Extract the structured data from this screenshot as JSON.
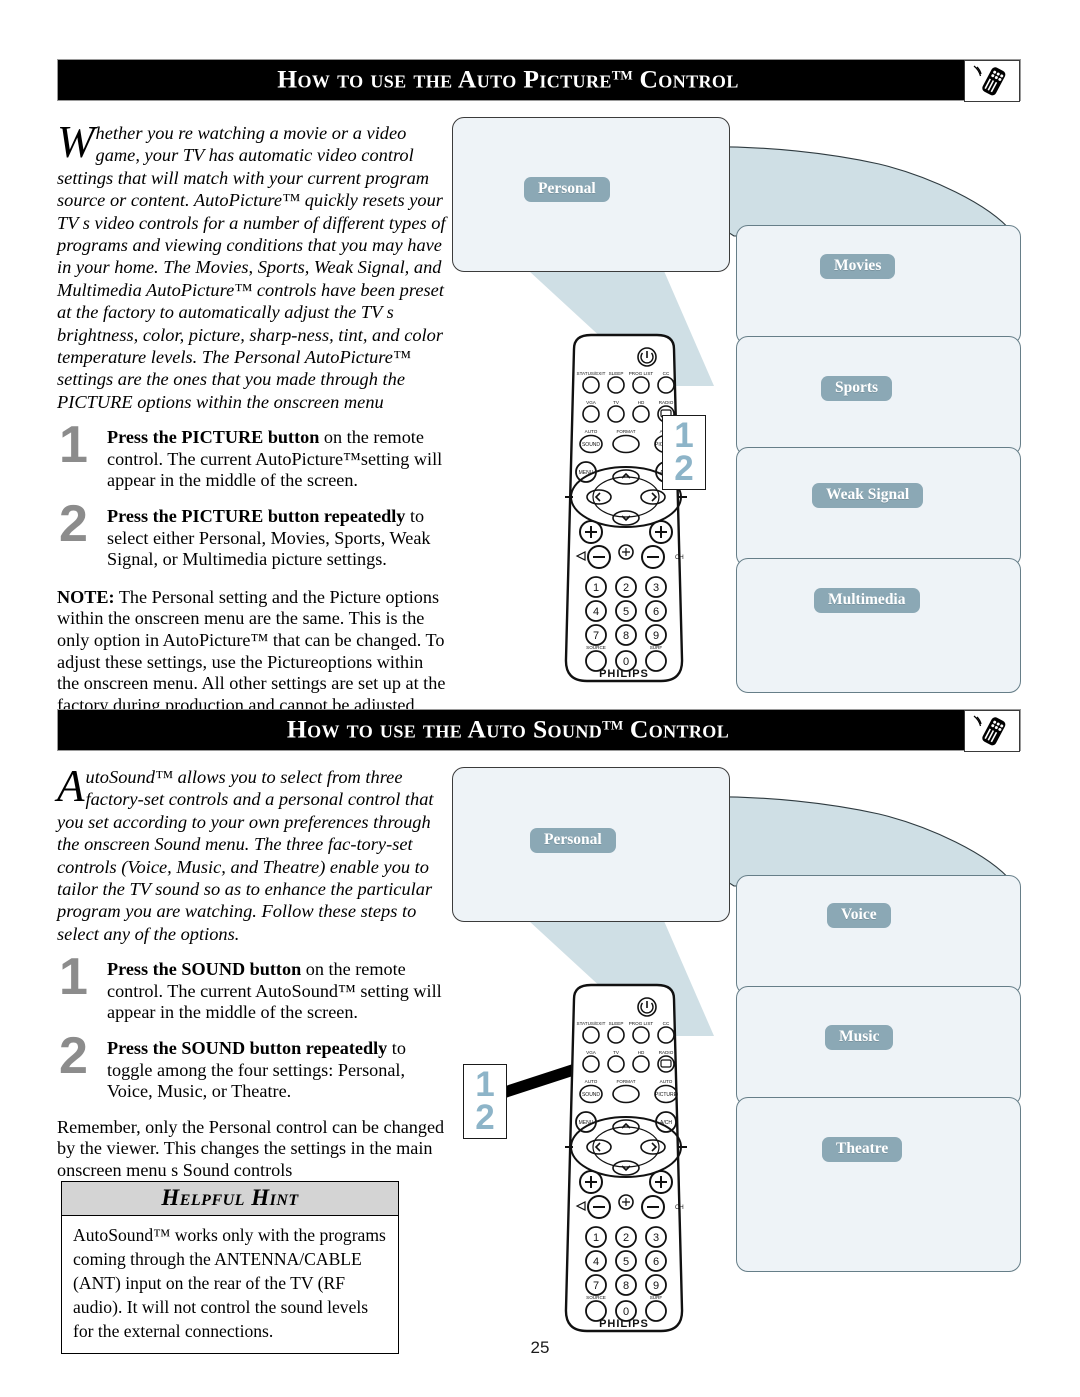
{
  "page": {
    "number": "25"
  },
  "section1": {
    "header": {
      "title_pre": "How to use the Auto Picture",
      "title_tm": "TM",
      "title_post": " Control",
      "icon": "remote-control-icon"
    },
    "intro": {
      "dropcap": "W",
      "text": "hether you re watching a movie or a video game, your TV has automatic video control settings that will match with your current program source or content.  AutoPicture™ quickly resets your TV s video controls for a number of different types of programs and viewing conditions that you may have in your home.  The Movies, Sports, Weak Signal, and Multimedia AutoPicture™ controls have been preset at the factory to automatically adjust the TV s brightness, color, picture, sharp-ness, tint, and color temperature levels.  The Personal AutoPicture™ settings are the ones that you made through the PICTURE options within the onscreen menu"
    },
    "steps": [
      {
        "number": "1",
        "bold": "Press the PICTURE button",
        "rest": " on the remote control.  The current AutoPicture™setting will appear in the middle of the screen."
      },
      {
        "number": "2",
        "bold": "Press the PICTURE button repeatedly",
        "rest": " to select either Personal, Movies, Sports, Weak Signal, or Multimedia picture settings."
      }
    ],
    "note": {
      "label": "NOTE:",
      "text": "  The Personal setting and the Picture options within the onscreen menu are the same. This is the only option in AutoPicture™ that can be changed. To adjust these settings, use the Pictureoptions within the onscreen menu. All other settings are set up at the factory during production and cannot be adjusted."
    },
    "diagram": {
      "callout": {
        "line1": "1",
        "line2": "2"
      },
      "panels": [
        {
          "label": "Personal"
        },
        {
          "label": "Movies"
        },
        {
          "label": "Sports"
        },
        {
          "label": "Weak Signal"
        },
        {
          "label": "Multimedia"
        }
      ]
    }
  },
  "section2": {
    "header": {
      "title_pre": "How to use the Auto Sound",
      "title_tm": "TM",
      "title_post": " Control",
      "icon": "remote-control-icon"
    },
    "intro": {
      "dropcap": "A",
      "text": "utoSound™ allows you to select from three factory-set controls and a personal control that you set according to your own preferences through the onscreen Sound menu. The three fac-tory-set controls (Voice, Music, and Theatre) enable you to tailor the TV sound so as to enhance the particular program you are watching.  Follow these steps to select any of the options."
    },
    "steps": [
      {
        "number": "1",
        "bold": "Press the SOUND button",
        "rest": " on the remote control.  The current AutoSound™ setting will appear in the middle of the screen."
      },
      {
        "number": "2",
        "bold": "Press the SOUND button repeatedly",
        "rest": " to toggle among the four settings:  Personal, Voice, Music, or Theatre."
      }
    ],
    "after": "Remember, only the Personal control can be changed by the viewer.  This changes the settings in the main onscreen menu s Sound controls",
    "hint": {
      "title": "Helpful Hint",
      "body": "AutoSound™ works only with the programs coming through the ANTENNA/CABLE (ANT) input on the rear of the TV (RF audio).  It will not control the sound levels for the external connections."
    },
    "diagram": {
      "callout": {
        "line1": "1",
        "line2": "2"
      },
      "panels": [
        {
          "label": "Personal"
        },
        {
          "label": "Voice"
        },
        {
          "label": "Music"
        },
        {
          "label": "Theatre"
        }
      ]
    }
  },
  "remote": {
    "brand": "PHILIPS",
    "rows": [
      [
        "STATUS/EXIT",
        "SLEEP",
        "PROG LIST",
        "CC"
      ],
      [
        "VGA",
        "TV",
        "HD",
        "RADIO"
      ],
      [
        "AUTO SOUND",
        "FORMAT",
        "AUTO PICTURE"
      ]
    ],
    "nav": {
      "menu": "MENU",
      "ach": "A/CH"
    },
    "volume_label": "VOL",
    "channel_label": "CH",
    "keypad": [
      "1",
      "2",
      "3",
      "4",
      "5",
      "6",
      "7",
      "8",
      "9",
      "0"
    ],
    "keypad_extra": {
      "source": "SOURCE",
      "surf": "SURF"
    }
  },
  "colors": {
    "header_bar": "#000000",
    "panel_fill": "#eef3f7",
    "badge_fill": "#8ba8b5",
    "beam_fill": "#cfdfe5",
    "callout_number": "#8db4c8",
    "step_number": "#8c8c8c",
    "hint_header": "#d4d4d4"
  }
}
